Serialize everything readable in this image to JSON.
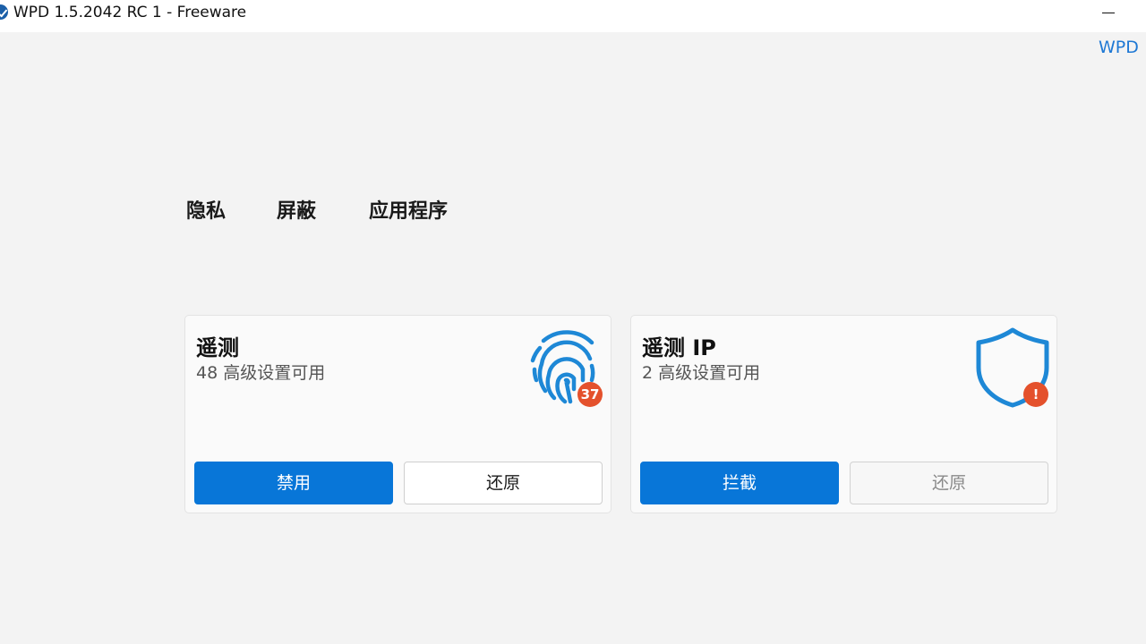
{
  "window": {
    "title": "WPD 1.5.2042 RC 1 - Freeware",
    "link": "WPD"
  },
  "tabs": [
    {
      "label": "隐私"
    },
    {
      "label": "屏蔽"
    },
    {
      "label": "应用程序"
    }
  ],
  "cards": [
    {
      "title": "遥测",
      "subtitle": "48 高级设置可用",
      "icon": "fingerprint-icon",
      "badge": "37",
      "primary_label": "禁用",
      "secondary_label": "还原"
    },
    {
      "title": "遥测 IP",
      "subtitle": "2 高级设置可用",
      "icon": "shield-icon",
      "badge": "!",
      "primary_label": "拦截",
      "secondary_label": "还原"
    }
  ],
  "colors": {
    "accent": "#0876d8",
    "icon_blue": "#1e88d6",
    "badge": "#e4512c",
    "link": "#1e78d4"
  }
}
